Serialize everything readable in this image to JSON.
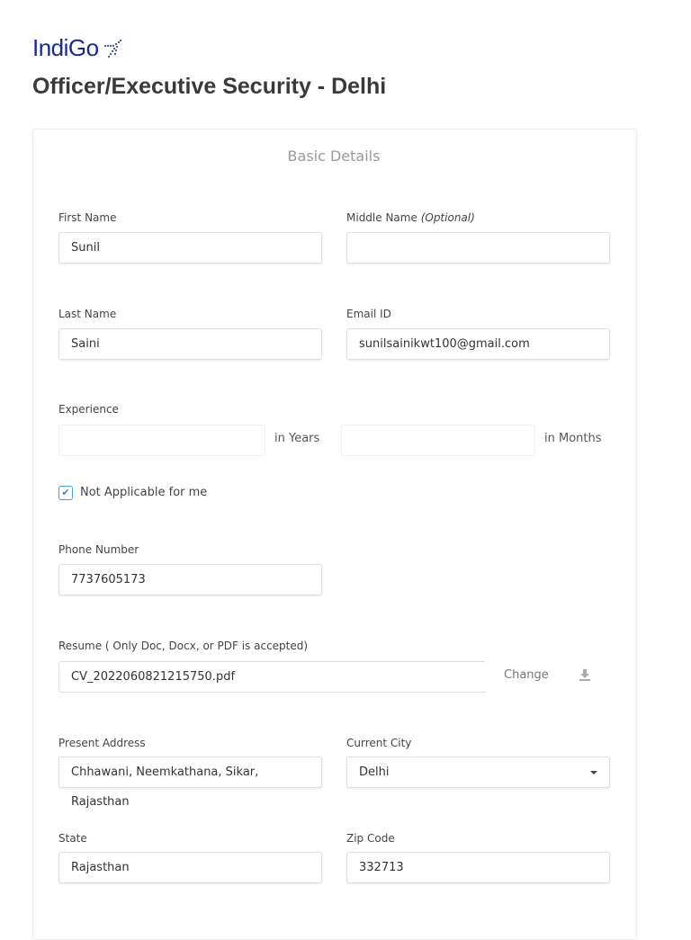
{
  "brand": {
    "name": "IndiGo",
    "accent": "#1b2a8c"
  },
  "page_title": "Officer/Executive Security - Delhi",
  "section_title": "Basic Details",
  "fields": {
    "first_name": {
      "label": "First Name",
      "value": "Sunil"
    },
    "middle_name": {
      "label": "Middle Name",
      "optional": "(Optional)",
      "value": ""
    },
    "last_name": {
      "label": "Last Name",
      "value": "Saini"
    },
    "email": {
      "label": "Email ID",
      "value": "sunilsainikwt100@gmail.com"
    },
    "experience": {
      "label": "Experience",
      "years_suffix": "in Years",
      "months_suffix": "in Months",
      "years": "",
      "months": ""
    },
    "not_applicable": {
      "label": "Not Applicable for me",
      "checked": true
    },
    "phone": {
      "label": "Phone Number",
      "value": "7737605173"
    },
    "resume": {
      "label": "Resume ( Only Doc, Docx, or PDF is accepted)",
      "value": "CV_2022060821215750.pdf",
      "change_label": "Change"
    },
    "present_address": {
      "label": "Present Address",
      "value": "Chhawani, Neemkathana, Sikar, Rajasthan"
    },
    "current_city": {
      "label": "Current City",
      "value": "Delhi"
    },
    "state": {
      "label": "State",
      "value": "Rajasthan"
    },
    "zip": {
      "label": "Zip Code",
      "value": "332713"
    }
  }
}
